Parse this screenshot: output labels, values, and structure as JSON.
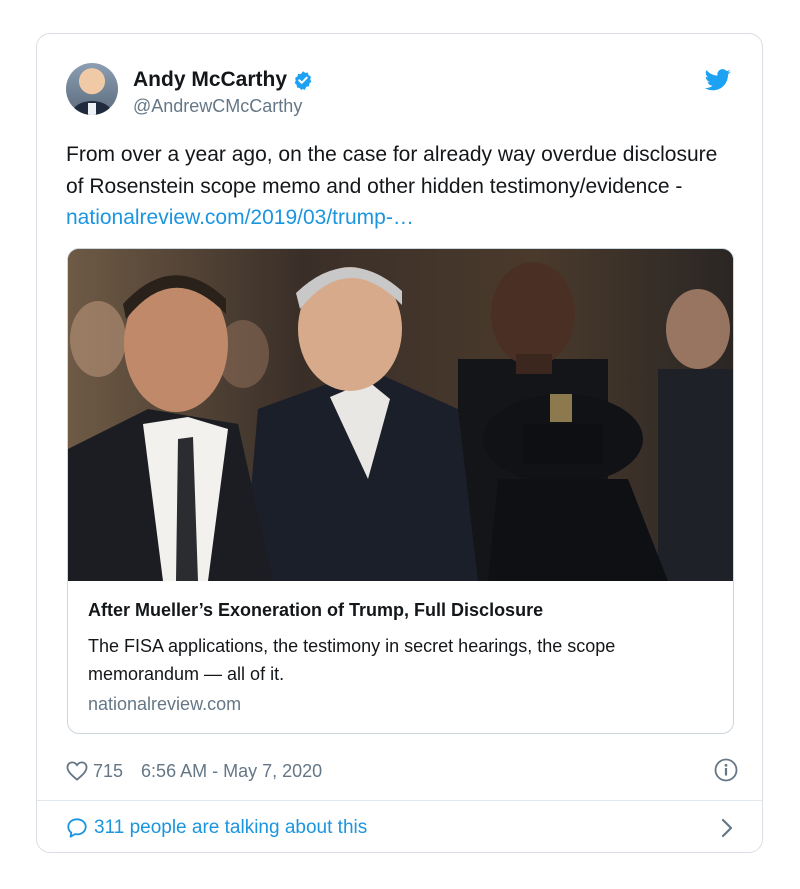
{
  "author": {
    "name": "Andy McCarthy",
    "handle": "@AndrewCMcCarthy",
    "verified": true,
    "avatar_icon": "avatar-photo"
  },
  "tweet": {
    "text": "From over a year ago, on the case for already way overdue disclosure of Rosenstein scope memo and other hidden testimony/evidence - ",
    "link_text": "nationalreview.com/2019/03/trump-…"
  },
  "link_card": {
    "title": "After Mueller’s Exoneration of Trump, Full Disclosure",
    "description": "The FISA applications, the testimony in secret hearings, the scope memorandum — all of it.",
    "domain": "nationalreview.com"
  },
  "footer": {
    "likes": "715",
    "timestamp": "6:56 AM - May 7, 2020",
    "talking": "311 people are talking about this"
  },
  "colors": {
    "link": "#1b95e0",
    "secondary_text": "#657786",
    "twitter_blue": "#1da1f2"
  },
  "icons": {
    "verified": "verified-badge-icon",
    "brand": "twitter-bird-icon",
    "like": "heart-icon",
    "info": "info-icon",
    "reply": "speech-bubble-icon",
    "more": "chevron-right-icon"
  }
}
